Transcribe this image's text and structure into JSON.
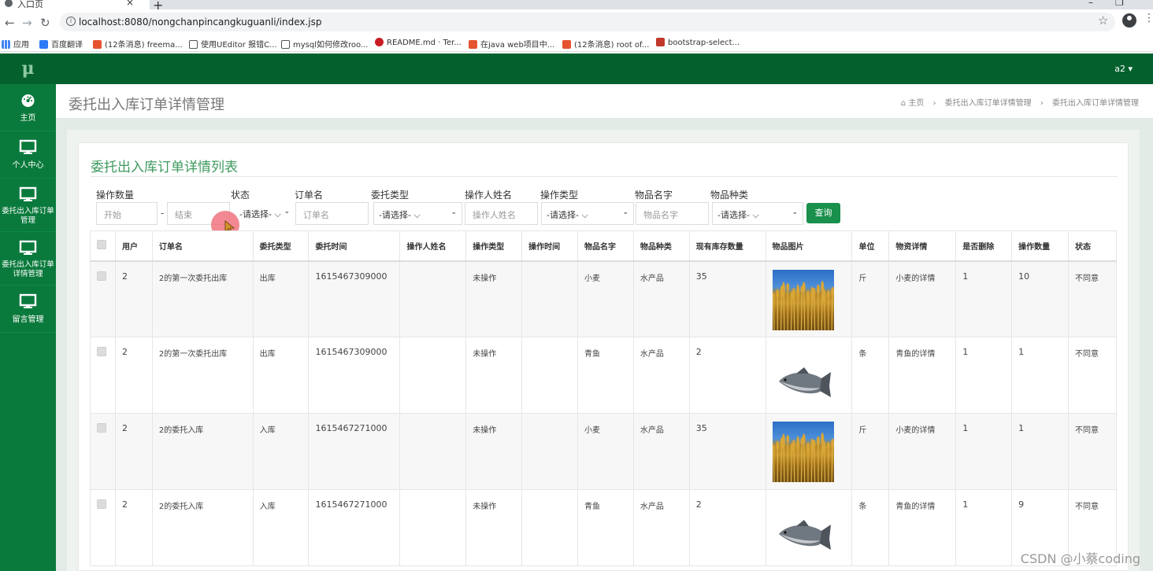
{
  "browser": {
    "tab_title": "入口页",
    "url": "localhost:8080/nongchanpincangkuguanli/index.jsp",
    "bookmarks": [
      "应用",
      "百度翻译",
      "(12条消息) freema...",
      "使用UEditor 报错C...",
      "mysql如何修改roo...",
      "README.md · Ter...",
      "在java web项目中...",
      "(12条消息) root of...",
      "bootstrap-select..."
    ]
  },
  "app": {
    "logo": "μ",
    "user_menu": "a2 ▾",
    "sidebar": [
      "主页",
      "个人中心",
      "委托出入库订单管理",
      "委托出入库订单详情管理",
      "留言管理"
    ],
    "page_title": "委托出入库订单详情管理",
    "breadcrumb": [
      "主页",
      "委托出入库订单详情管理",
      "委托出入库订单详情管理"
    ]
  },
  "panel": {
    "title": "委托出入库订单详情列表",
    "filters": {
      "qty_label": "操作数量",
      "qty_start_placeholder": "开始",
      "qty_end_placeholder": "结束",
      "qty_dash": "-",
      "status_label": "状态",
      "status_value": "-请选择-",
      "order_label": "订单名",
      "order_placeholder": "订单名",
      "entrust_type_label": "委托类型",
      "entrust_type_value": "-请选择-",
      "operator_label": "操作人姓名",
      "operator_placeholder": "操作人姓名",
      "op_type_label": "操作类型",
      "op_type_value": "-请选择-",
      "goods_name_label": "物品名字",
      "goods_name_placeholder": "物品名字",
      "goods_kind_label": "物品种类",
      "goods_kind_value": "-请选择-",
      "query_button": "查询"
    },
    "columns": [
      "用户",
      "订单名",
      "委托类型",
      "委托时间",
      "操作人姓名",
      "操作类型",
      "操作时间",
      "物品名字",
      "物品种类",
      "现有库存数量",
      "物品图片",
      "单位",
      "物资详情",
      "是否删除",
      "操作数量",
      "状态"
    ],
    "rows": [
      {
        "user": "2",
        "order": "2的第一次委托出库",
        "type": "出库",
        "time": "1615467309000",
        "operator": "",
        "op_type": "未操作",
        "op_time": "",
        "goods": "小麦",
        "kind": "水产品",
        "stock": "35",
        "image": "wheat",
        "unit": "斤",
        "detail": "小麦的详情",
        "deleted": "1",
        "qty": "10",
        "status": "不同意"
      },
      {
        "user": "2",
        "order": "2的第一次委托出库",
        "type": "出库",
        "time": "1615467309000",
        "operator": "",
        "op_type": "未操作",
        "op_time": "",
        "goods": "青鱼",
        "kind": "水产品",
        "stock": "2",
        "image": "fish",
        "unit": "条",
        "detail": "青鱼的详情",
        "deleted": "1",
        "qty": "1",
        "status": "不同意"
      },
      {
        "user": "2",
        "order": "2的委托入库",
        "type": "入库",
        "time": "1615467271000",
        "operator": "",
        "op_type": "未操作",
        "op_time": "",
        "goods": "小麦",
        "kind": "水产品",
        "stock": "35",
        "image": "wheat",
        "unit": "斤",
        "detail": "小麦的详情",
        "deleted": "1",
        "qty": "1",
        "status": "不同意"
      },
      {
        "user": "2",
        "order": "2的委托入库",
        "type": "入库",
        "time": "1615467271000",
        "operator": "",
        "op_type": "未操作",
        "op_time": "",
        "goods": "青鱼",
        "kind": "水产品",
        "stock": "2",
        "image": "fish",
        "unit": "条",
        "detail": "青鱼的详情",
        "deleted": "1",
        "qty": "9",
        "status": "不同意"
      }
    ]
  },
  "watermark": "CSDN @小蔡coding"
}
